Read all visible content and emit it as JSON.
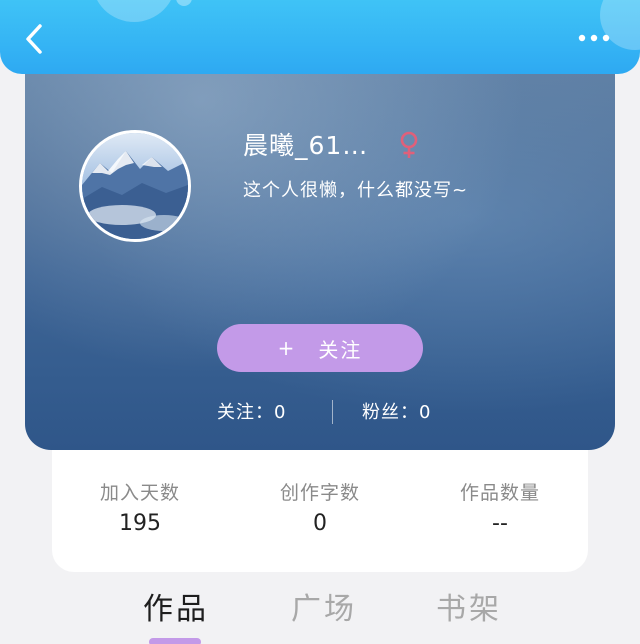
{
  "header": {
    "back_icon": "chevron-left-icon",
    "more_icon": "more-dots-icon",
    "bar_color": "#35b4f4"
  },
  "profile": {
    "username": "晨曦_61…",
    "gender_icon": "female-icon",
    "gender_color": "#e0607a",
    "bio": "这个人很懒，什么都没写~",
    "follow_button": {
      "plus": "+",
      "label": "关注",
      "color": "#c39ae8"
    },
    "following": "关注：0",
    "fans": "粉丝：0"
  },
  "stats": [
    {
      "label": "加入天数",
      "value": "195"
    },
    {
      "label": "创作字数",
      "value": "0"
    },
    {
      "label": "作品数量",
      "value": "--"
    }
  ],
  "tabs": [
    {
      "label": "作品",
      "active": true
    },
    {
      "label": "广场",
      "active": false
    },
    {
      "label": "书架",
      "active": false
    }
  ]
}
